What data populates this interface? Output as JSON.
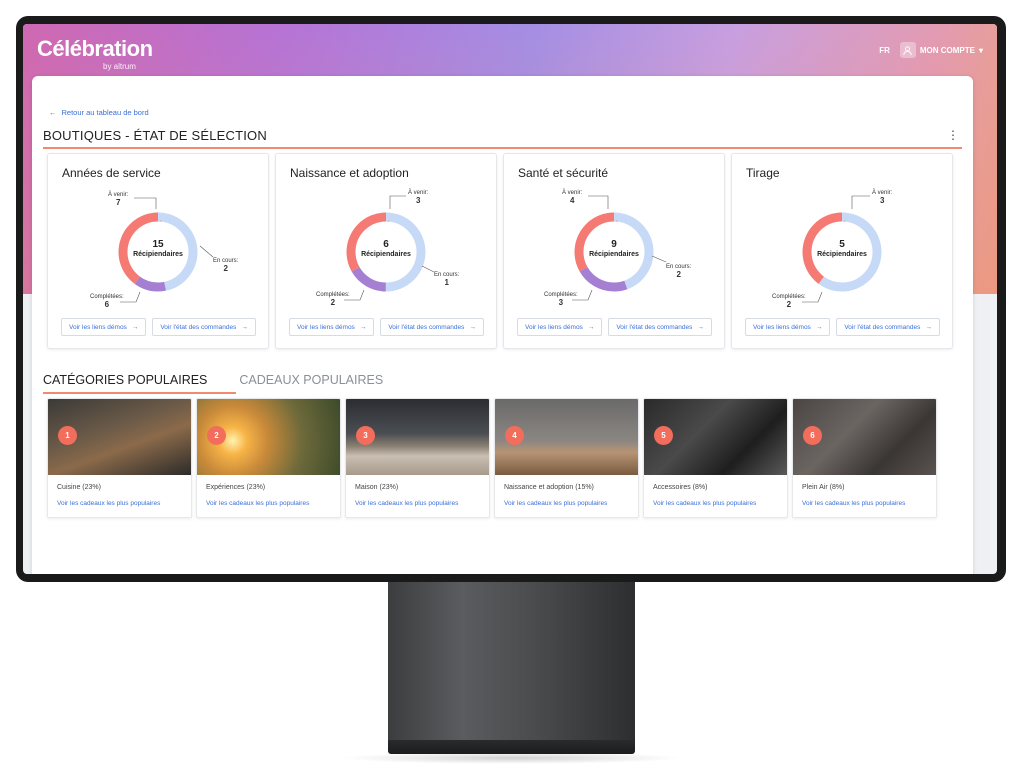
{
  "app": {
    "logo_name": "Célébration",
    "logo_sub": "by altrum"
  },
  "header": {
    "language": "FR",
    "account_label": "MON COMPTE"
  },
  "page": {
    "back_link": "Retour au tableau de bord",
    "title": "BOUTIQUES - ÉTAT DE SÉLECTION"
  },
  "legend_labels": {
    "a_venir": "À venir:",
    "en_cours": "En cours:",
    "completees": "Complétées:",
    "center": "Récipiendaires"
  },
  "colors": {
    "a_venir": "#c6d9f7",
    "en_cours": "#a57fd1",
    "completees": "#f47a73",
    "accent": "#f08a70",
    "link": "#3b6fd8"
  },
  "shops": [
    {
      "name": "Années de service",
      "total": "15",
      "a_venir": "7",
      "en_cours": "2",
      "completees": "6",
      "btn_demo": "Voir les liens démos",
      "btn_orders": "Voir l'état des commandes"
    },
    {
      "name": "Naissance et adoption",
      "total": "6",
      "a_venir": "3",
      "en_cours": "1",
      "completees": "2",
      "btn_demo": "Voir les liens démos",
      "btn_orders": "Voir l'état des commandes"
    },
    {
      "name": "Santé et sécurité",
      "total": "9",
      "a_venir": "4",
      "en_cours": "2",
      "completees": "3",
      "btn_demo": "Voir les liens démos",
      "btn_orders": "Voir l'état des commandes"
    },
    {
      "name": "Tirage",
      "total": "5",
      "a_venir": "3",
      "en_cours": "0",
      "completees": "2",
      "btn_demo": "Voir les liens démos",
      "btn_orders": "Voir l'état des commandes"
    }
  ],
  "tabs": [
    {
      "label": "CATÉGORIES POPULAIRES",
      "active": true
    },
    {
      "label": "CADEAUX POPULAIRES",
      "active": false
    }
  ],
  "categories": [
    {
      "rank": "1",
      "name": "Cuisine (23%)",
      "link": "Voir les cadeaux les plus populaires",
      "image": "kitchen-photo"
    },
    {
      "rank": "2",
      "name": "Expériences (23%)",
      "link": "Voir les cadeaux les plus populaires",
      "image": "sunset-field-photo"
    },
    {
      "rank": "3",
      "name": "Maison (23%)",
      "link": "Voir les cadeaux les plus populaires",
      "image": "living-room-photo"
    },
    {
      "rank": "4",
      "name": "Naissance et adoption (15%)",
      "link": "Voir les cadeaux les plus populaires",
      "image": "nursery-photo"
    },
    {
      "rank": "5",
      "name": "Accessoires (8%)",
      "link": "Voir les cadeaux les plus populaires",
      "image": "shoes-accessories-photo"
    },
    {
      "rank": "6",
      "name": "Plein Air (8%)",
      "link": "Voir les cadeaux les plus populaires",
      "image": "binoculars-photo"
    }
  ]
}
